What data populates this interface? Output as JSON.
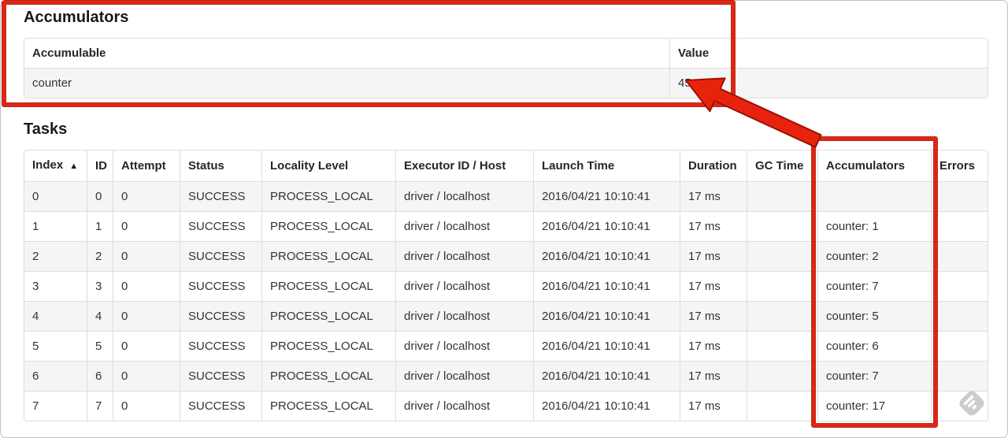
{
  "accumulators_section": {
    "title": "Accumulators",
    "table": {
      "headers": [
        "Accumulable",
        "Value"
      ],
      "rows": [
        {
          "accumulable": "counter",
          "value": "45"
        }
      ]
    }
  },
  "tasks_section": {
    "title": "Tasks",
    "table": {
      "headers": [
        "Index",
        "ID",
        "Attempt",
        "Status",
        "Locality Level",
        "Executor ID / Host",
        "Launch Time",
        "Duration",
        "GC Time",
        "Accumulators",
        "Errors"
      ],
      "sort_column": "Index",
      "sort_icon": "▲",
      "rows": [
        {
          "index": "0",
          "id": "0",
          "attempt": "0",
          "status": "SUCCESS",
          "locality": "PROCESS_LOCAL",
          "executor": "driver / localhost",
          "launch": "2016/04/21 10:10:41",
          "duration": "17 ms",
          "gc": "",
          "accum": "",
          "errors": ""
        },
        {
          "index": "1",
          "id": "1",
          "attempt": "0",
          "status": "SUCCESS",
          "locality": "PROCESS_LOCAL",
          "executor": "driver / localhost",
          "launch": "2016/04/21 10:10:41",
          "duration": "17 ms",
          "gc": "",
          "accum": "counter: 1",
          "errors": ""
        },
        {
          "index": "2",
          "id": "2",
          "attempt": "0",
          "status": "SUCCESS",
          "locality": "PROCESS_LOCAL",
          "executor": "driver / localhost",
          "launch": "2016/04/21 10:10:41",
          "duration": "17 ms",
          "gc": "",
          "accum": "counter: 2",
          "errors": ""
        },
        {
          "index": "3",
          "id": "3",
          "attempt": "0",
          "status": "SUCCESS",
          "locality": "PROCESS_LOCAL",
          "executor": "driver / localhost",
          "launch": "2016/04/21 10:10:41",
          "duration": "17 ms",
          "gc": "",
          "accum": "counter: 7",
          "errors": ""
        },
        {
          "index": "4",
          "id": "4",
          "attempt": "0",
          "status": "SUCCESS",
          "locality": "PROCESS_LOCAL",
          "executor": "driver / localhost",
          "launch": "2016/04/21 10:10:41",
          "duration": "17 ms",
          "gc": "",
          "accum": "counter: 5",
          "errors": ""
        },
        {
          "index": "5",
          "id": "5",
          "attempt": "0",
          "status": "SUCCESS",
          "locality": "PROCESS_LOCAL",
          "executor": "driver / localhost",
          "launch": "2016/04/21 10:10:41",
          "duration": "17 ms",
          "gc": "",
          "accum": "counter: 6",
          "errors": ""
        },
        {
          "index": "6",
          "id": "6",
          "attempt": "0",
          "status": "SUCCESS",
          "locality": "PROCESS_LOCAL",
          "executor": "driver / localhost",
          "launch": "2016/04/21 10:10:41",
          "duration": "17 ms",
          "gc": "",
          "accum": "counter: 7",
          "errors": ""
        },
        {
          "index": "7",
          "id": "7",
          "attempt": "0",
          "status": "SUCCESS",
          "locality": "PROCESS_LOCAL",
          "executor": "driver / localhost",
          "launch": "2016/04/21 10:10:41",
          "duration": "17 ms",
          "gc": "",
          "accum": "counter: 17",
          "errors": ""
        }
      ]
    }
  },
  "annotations": {
    "highlight_color": "#e8230d",
    "highlight_outline_color": "#9b1004",
    "box_1_target": "accumulators-summary-table",
    "box_2_target": "tasks-accumulators-column",
    "arrow_target": "accumulator-value-45"
  },
  "icons": {
    "sort_ascending": "triangle-up",
    "watermark": "gray-diamond-stripes"
  },
  "colors": {
    "table_border": "#dddddd",
    "row_stripe": "#f5f5f5",
    "text": "#333333",
    "watermark_gray": "#cbcbcb"
  }
}
